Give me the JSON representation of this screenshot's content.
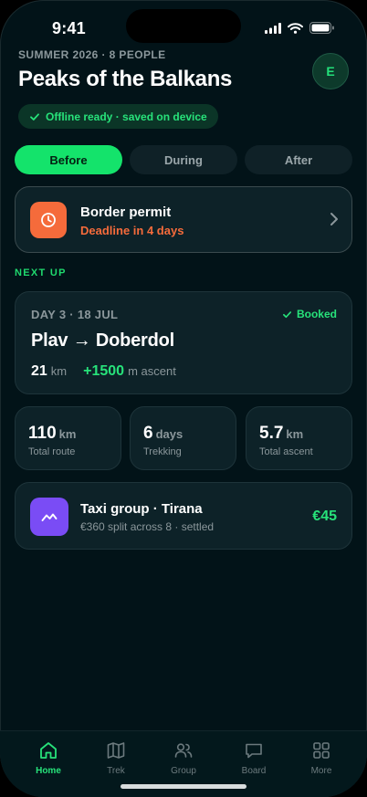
{
  "status": {
    "time": "9:41"
  },
  "trip": {
    "eyebrow": "SUMMER 2026 · 8 PEOPLE",
    "title": "Peaks of the Balkans",
    "avatar_initial": "E",
    "offline_label": "Offline ready · saved on device"
  },
  "segments": [
    {
      "label": "Before",
      "active": true
    },
    {
      "label": "During",
      "active": false
    },
    {
      "label": "After",
      "active": false
    }
  ],
  "permit": {
    "title": "Border permit",
    "subtitle": "Deadline in 4 days",
    "icon": "clock-icon",
    "accent": "#f56b3b"
  },
  "next_up": {
    "section_label": "NEXT UP",
    "day": "DAY 3 · 18 JUL",
    "status": "Booked",
    "route": "Plav → Doberdol",
    "distance_value": "21",
    "distance_unit": "km",
    "ascent_value": "+1500",
    "ascent_unit": "m ascent"
  },
  "stats": [
    {
      "value": "110",
      "unit": "km",
      "label": "Total route"
    },
    {
      "value": "6",
      "unit": "days",
      "label": "Trekking"
    },
    {
      "value": "5.7",
      "unit": "km",
      "label": "Total ascent"
    }
  ],
  "expense": {
    "title": "Taxi group · Tirana",
    "subtitle": "€360 split across 8 · settled",
    "amount": "€45",
    "icon": "trend-icon",
    "accent": "#7a4cf5"
  },
  "tabs": [
    {
      "label": "Home",
      "icon": "home-icon",
      "active": true
    },
    {
      "label": "Trek",
      "icon": "map-icon",
      "active": false
    },
    {
      "label": "Group",
      "icon": "group-icon",
      "active": false
    },
    {
      "label": "Board",
      "icon": "chat-icon",
      "active": false
    },
    {
      "label": "More",
      "icon": "grid-icon",
      "active": false
    }
  ],
  "colors": {
    "brand": "#14e36b",
    "background": "#021318",
    "card": "#0d2228"
  }
}
